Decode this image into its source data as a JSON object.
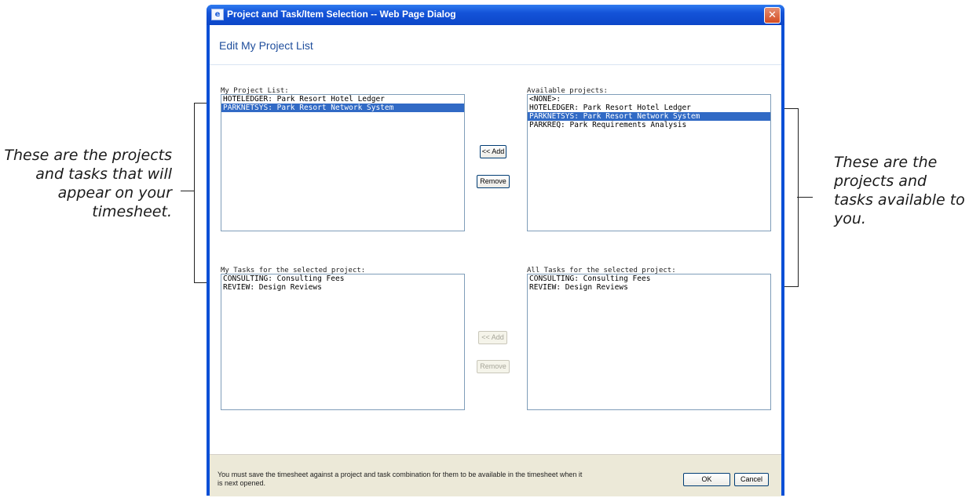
{
  "callouts": {
    "left_text": "These are the projects and tasks that will appear on your timesheet.",
    "right_text": "These are the projects and tasks available to you."
  },
  "window": {
    "title": "Project and Task/Item Selection -- Web Page Dialog",
    "icon": "ie-document-icon",
    "close_label": "✕"
  },
  "dialog": {
    "heading": "Edit My Project List"
  },
  "my_projects": {
    "label": "My Project List:",
    "items": [
      {
        "text": "HOTELEDGER: Park Resort Hotel Ledger",
        "selected": false
      },
      {
        "text": "PARKNETSYS: Park Resort Network System",
        "selected": true
      }
    ]
  },
  "available_projects": {
    "label": "Available projects:",
    "items": [
      {
        "text": "<NONE>:",
        "selected": false
      },
      {
        "text": "HOTELEDGER: Park Resort Hotel Ledger",
        "selected": false
      },
      {
        "text": "PARKNETSYS: Park Resort Network System",
        "selected": true
      },
      {
        "text": "PARKREQ: Park Requirements Analysis",
        "selected": false
      }
    ]
  },
  "project_buttons": {
    "add_label": "<< Add",
    "remove_label": "Remove"
  },
  "my_tasks": {
    "label": "My Tasks for the selected project:",
    "items": [
      {
        "text": "CONSULTING: Consulting Fees",
        "selected": false
      },
      {
        "text": "REVIEW: Design Reviews",
        "selected": false
      }
    ]
  },
  "all_tasks": {
    "label": "All Tasks for the selected project:",
    "items": [
      {
        "text": "CONSULTING: Consulting Fees",
        "selected": false
      },
      {
        "text": "REVIEW: Design Reviews",
        "selected": false
      }
    ]
  },
  "task_buttons": {
    "add_label": "<< Add",
    "remove_label": "Remove"
  },
  "footer": {
    "message": "You must save the timesheet against a project and task combination for them to be available in the timesheet when it is next opened.",
    "ok_label": "OK",
    "cancel_label": "Cancel"
  },
  "colors": {
    "window_frame": "#0a4fd6",
    "selection": "#316ac5",
    "heading": "#1f4e9c"
  }
}
